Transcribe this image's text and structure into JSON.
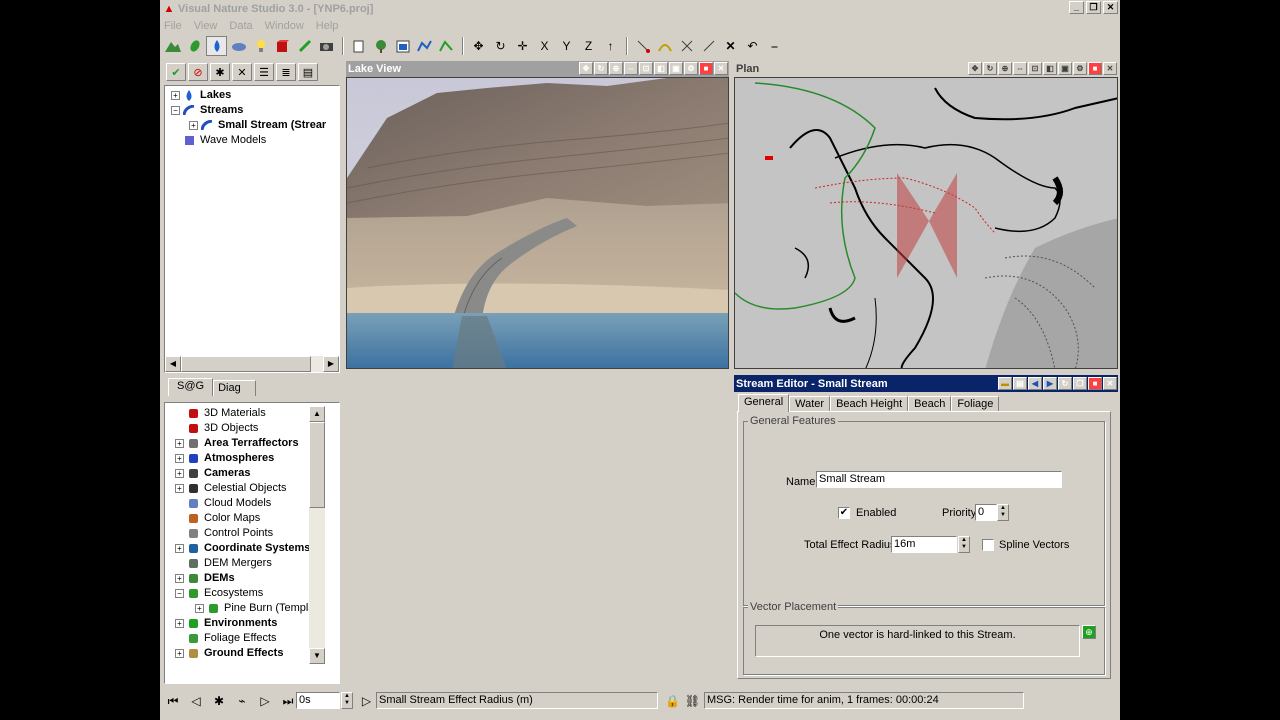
{
  "window": {
    "title": "Visual Nature Studio 3.0  - [YNP6.proj]",
    "minimize": "_",
    "restore": "❐",
    "close": "✕"
  },
  "menu": [
    "File",
    "View",
    "Data",
    "Window",
    "Help"
  ],
  "toolbar_icons": [
    "terrain-icon",
    "leaf-icon",
    "water-drop-icon",
    "cloud-icon",
    "lightbulb-icon",
    "cube-icon",
    "brush-icon",
    "camera-icon",
    "document-icon",
    "foliage-icon",
    "image-icon",
    "vector-icon",
    "edit-vector-icon",
    "move-icon",
    "rotate-icon",
    "move-axis-icon",
    "x-axis-button",
    "y-axis-button",
    "z-axis-button",
    "up-arrow-icon",
    "add-point-icon",
    "path-icon",
    "delete-points-icon",
    "delete-icon",
    "close-x-icon",
    "undo-icon",
    "line-icon"
  ],
  "toolbar_axis": {
    "x": "X",
    "y": "Y",
    "z": "Z"
  },
  "lakes_tree": {
    "items": [
      {
        "label": "Lakes",
        "expander": "+"
      },
      {
        "label": "Streams",
        "expander": "−"
      },
      {
        "label": "Small Stream (Strear",
        "expander": "+"
      },
      {
        "label": "Wave Models"
      }
    ]
  },
  "lower_tabs": [
    "S@G",
    "Diag"
  ],
  "component_list": [
    {
      "label": "3D Materials",
      "bold": false,
      "expander": ""
    },
    {
      "label": "3D Objects",
      "bold": false,
      "expander": ""
    },
    {
      "label": "Area Terraffectors",
      "bold": true,
      "expander": "+"
    },
    {
      "label": "Atmospheres",
      "bold": true,
      "expander": "+"
    },
    {
      "label": "Cameras",
      "bold": true,
      "expander": "+"
    },
    {
      "label": "Celestial Objects",
      "bold": false,
      "expander": "+"
    },
    {
      "label": "Cloud Models",
      "bold": false,
      "expander": ""
    },
    {
      "label": "Color Maps",
      "bold": false,
      "expander": ""
    },
    {
      "label": "Control Points",
      "bold": false,
      "expander": ""
    },
    {
      "label": "Coordinate Systems",
      "bold": true,
      "expander": "+"
    },
    {
      "label": "DEM Mergers",
      "bold": false,
      "expander": ""
    },
    {
      "label": "DEMs",
      "bold": true,
      "expander": "+"
    },
    {
      "label": "Ecosystems",
      "bold": false,
      "expander": "−"
    },
    {
      "label": "Pine Burn (Templa",
      "bold": false,
      "expander": "+",
      "indent": true
    },
    {
      "label": "Environments",
      "bold": true,
      "expander": "+"
    },
    {
      "label": "Foliage Effects",
      "bold": false,
      "expander": ""
    },
    {
      "label": "Ground Effects",
      "bold": true,
      "expander": "+"
    }
  ],
  "views": {
    "lake": "Lake View",
    "plan": "Plan"
  },
  "stream_editor": {
    "title": "Stream Editor - Small Stream",
    "tabs": [
      "General",
      "Water",
      "Beach Height",
      "Beach",
      "Foliage"
    ],
    "group_general": "General Features",
    "name_label": "Name",
    "name_value": "Small Stream",
    "enabled_label": "Enabled",
    "enabled_checked": true,
    "priority_label": "Priority",
    "priority_value": "0",
    "radius_label": "Total Effect Radius",
    "radius_value": "16m",
    "spline_label": "Spline Vectors",
    "spline_checked": false,
    "group_vector": "Vector Placement",
    "vector_text": "One vector is hard-linked to this Stream."
  },
  "status": {
    "time_value": "0s",
    "param_text": "Small Stream Effect Radius (m)",
    "msg_text": "MSG: Render time for anim, 1 frames:  00:00:24"
  },
  "colors": {
    "app_bg": "#d4d0c8",
    "editor_title_bg": "#0a246a",
    "lake_blue": "#5a8aa8",
    "plan_bg": "#c8c8c8"
  }
}
